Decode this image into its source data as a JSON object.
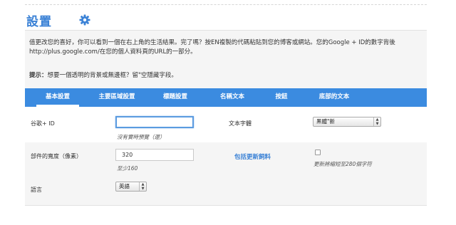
{
  "header": {
    "title": "設置",
    "gear_icon": "gear-icon",
    "accent": "#3b82d6"
  },
  "intro": {
    "text": "值更改您的喜好，你可以看到一個在右上角的生活結果。完了嗎？按EN複製的代碼粘貼到您的博客或網站。您的Google + ID的數字背後http://plus.google.com/在您的個人資料頁的URL的一部分。",
    "tip_prefix": "提示：",
    "tip_text": "想要一個透明的背景或無邊框？留\"空隱藏字段。"
  },
  "tabs": [
    {
      "label": "基本設置",
      "active": true
    },
    {
      "label": "主要區域設置",
      "active": false
    },
    {
      "label": "標題設置",
      "active": false
    },
    {
      "label": "名稱文本",
      "active": false
    },
    {
      "label": "按鈕",
      "active": false
    },
    {
      "label": "底部的文本",
      "active": false
    }
  ],
  "form": {
    "google_id": {
      "label": "谷歌+ ID",
      "value": "",
      "hint": "沒有實時預覽（還）"
    },
    "font": {
      "label": "文本字體",
      "selected": "黑體\"新"
    },
    "width": {
      "label": "部件的寬度（像素）",
      "value": "320",
      "hint": "至少160"
    },
    "update_link": {
      "label": "包括更新飼料"
    },
    "update_checkbox": {
      "checked": false,
      "hint": "更新將縮短至280個字符"
    },
    "language": {
      "label": "語言",
      "selected": "英語"
    }
  },
  "colors": {
    "tab_bar": "#3b8be0",
    "panel": "#f5f5f5",
    "link": "#3b82d6"
  }
}
